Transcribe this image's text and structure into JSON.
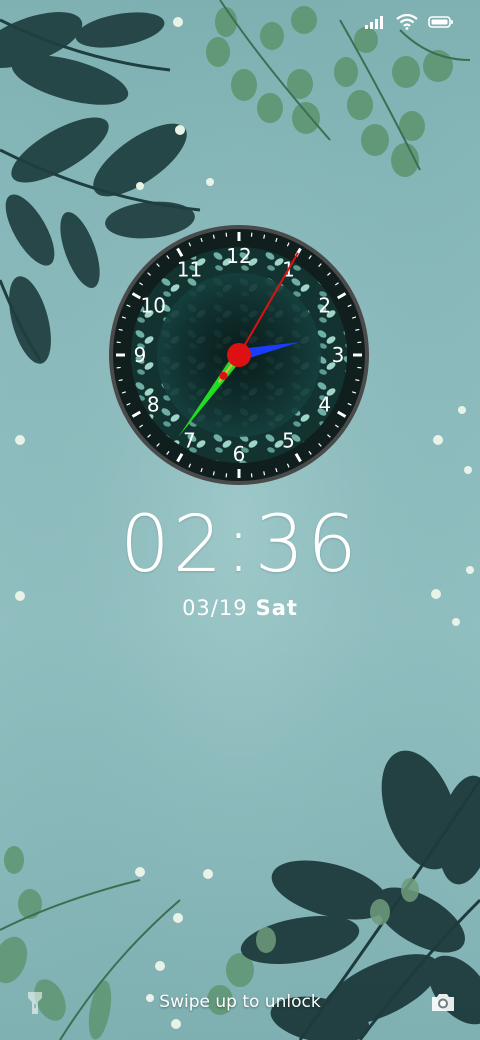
{
  "lockscreen": {
    "time": "02:36",
    "date": "03/19",
    "weekday": "Sat",
    "swipe_hint": "Swipe up to unlock"
  },
  "clock": {
    "hour": 2,
    "minute": 36,
    "second": 5,
    "numerals": [
      "12",
      "1",
      "2",
      "3",
      "4",
      "5",
      "6",
      "7",
      "8",
      "9",
      "10",
      "11"
    ],
    "colors": {
      "hour_hand": "#1a3cff",
      "minute_hand": "#22dd22",
      "second_hand": "#dd1111",
      "center_dot": "#dd1111",
      "dial": "#0b2422"
    }
  },
  "status_bar": {
    "icons": [
      "signal-icon",
      "wifi-icon",
      "battery-icon"
    ]
  },
  "shortcuts": {
    "left": "flashlight-icon",
    "right": "camera-icon"
  }
}
